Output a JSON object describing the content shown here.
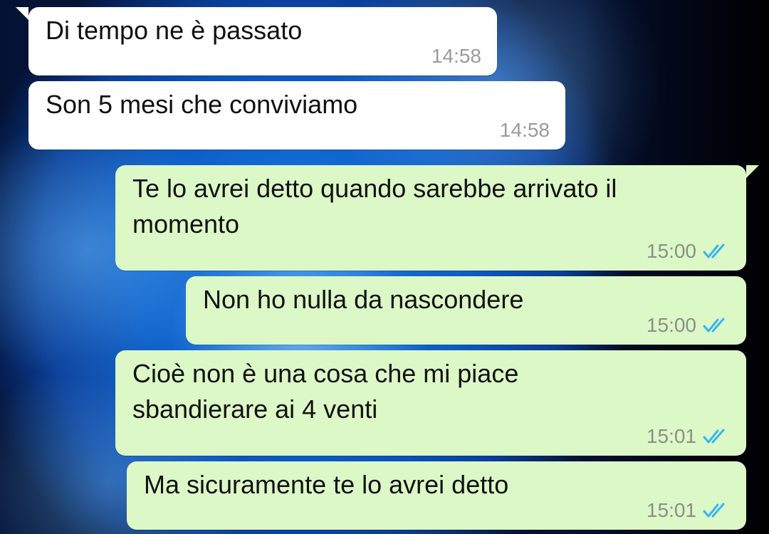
{
  "chat": {
    "messages": [
      {
        "direction": "incoming",
        "text": "Di tempo ne è passato",
        "time": "14:58"
      },
      {
        "direction": "incoming",
        "text": "Son 5 mesi che conviviamo",
        "time": "14:58"
      },
      {
        "direction": "outgoing",
        "text": "Te lo avrei detto quando sarebbe arrivato il\nmomento",
        "time": "15:00",
        "status_icon": "double-check-read-icon"
      },
      {
        "direction": "outgoing",
        "text": "Non ho nulla da nascondere",
        "time": "15:00",
        "status_icon": "double-check-read-icon"
      },
      {
        "direction": "outgoing",
        "text": "Cioè non è una cosa che mi piace\nsbandierare ai 4 venti",
        "time": "15:01",
        "status_icon": "double-check-read-icon"
      },
      {
        "direction": "outgoing",
        "text": "Ma sicuramente te lo avrei detto",
        "time": "15:01",
        "status_icon": "double-check-read-icon"
      }
    ]
  },
  "colors": {
    "incoming_bubble": "#ffffff",
    "outgoing_bubble": "#dcf8c6",
    "read_tick": "#34b7f1",
    "timestamp": "#8a8f8a"
  }
}
